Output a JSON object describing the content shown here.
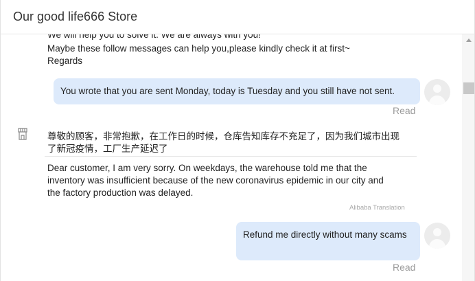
{
  "header": {
    "title": "Our good life666 Store"
  },
  "messages": {
    "cutoff_line": "We will help you to solve it. We are always with you!",
    "seller_lines": [
      "Maybe these follow messages can help you,please kindly check it at first~",
      "Regards"
    ],
    "user_message_1": {
      "text": "You wrote that you are sent Monday, today is Tuesday and you still have not sent.",
      "status": "Read"
    },
    "seller_reply": {
      "original_lines": [
        "尊敬的顾客，非常抱歉，在工作日的时候，仓库告知库存不充足了，因为我们城市出现",
        "了新冠疫情，工厂生产延迟了"
      ],
      "translation_lines": [
        "Dear customer, I am very sorry. On weekdays, the warehouse told me that the",
        "inventory was insufficient because of the new coronavirus epidemic in our city and",
        "the factory production was delayed."
      ],
      "translation_source": "Alibaba Translation"
    },
    "user_message_2": {
      "text": "Refund me directly without many scams",
      "status": "Read"
    }
  },
  "icons": {
    "store": "store-icon",
    "avatar": "user-avatar-icon",
    "scroll_up": "scroll-up-arrow-icon"
  },
  "colors": {
    "user_bubble": "#ddeafb",
    "read_status": "#9a9a9a"
  }
}
